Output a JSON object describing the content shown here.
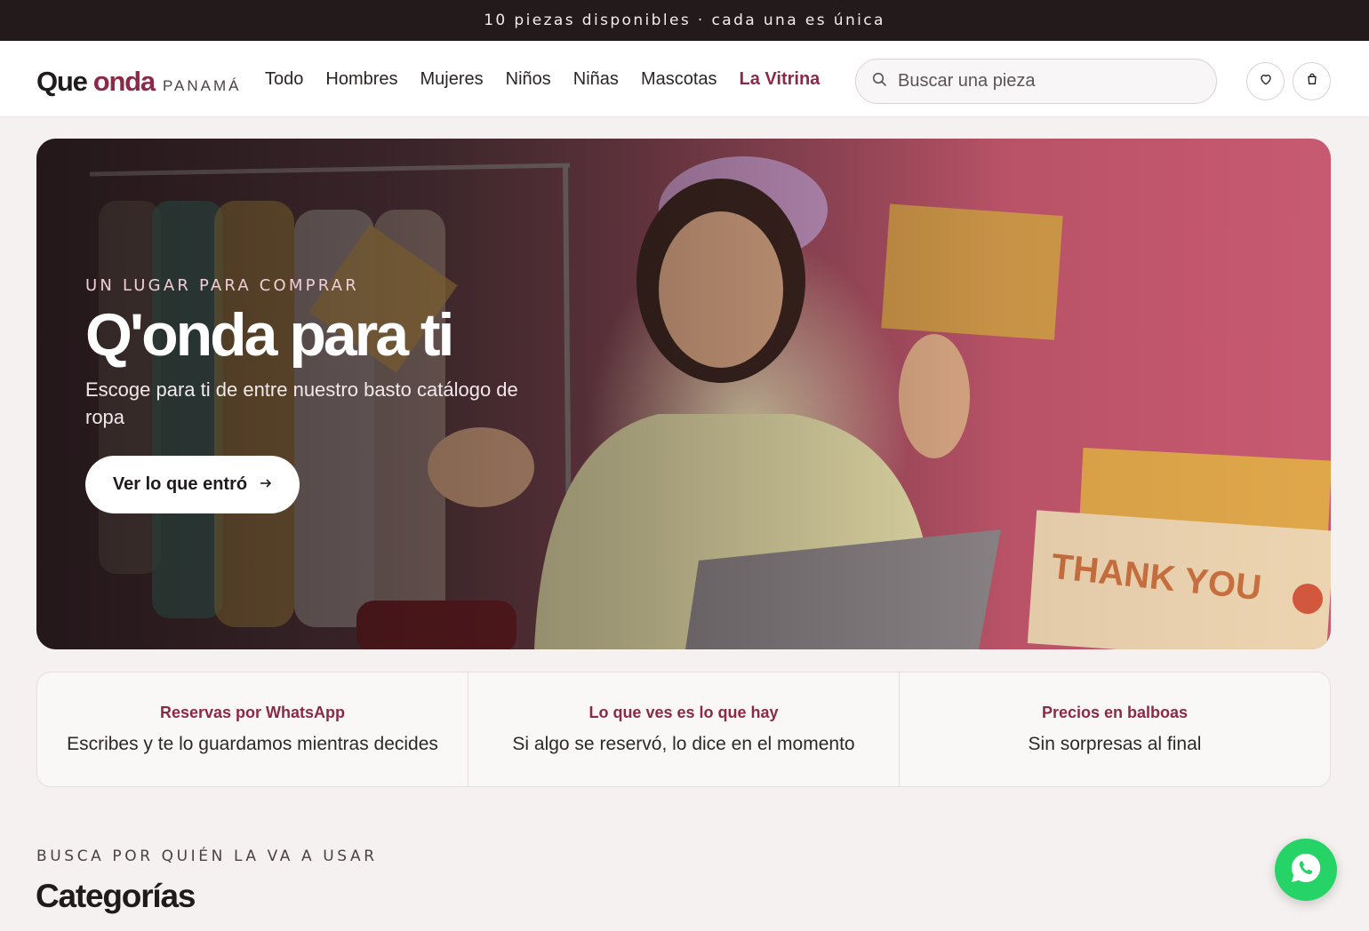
{
  "announcement": "10 piezas disponibles · cada una es única",
  "logo": {
    "part1": "Que",
    "part2": "onda",
    "part3": "PANAMÁ"
  },
  "nav": [
    {
      "label": "Todo"
    },
    {
      "label": "Hombres"
    },
    {
      "label": "Mujeres"
    },
    {
      "label": "Niños"
    },
    {
      "label": "Niñas"
    },
    {
      "label": "Mascotas"
    },
    {
      "label": "La Vitrina",
      "accent": true
    }
  ],
  "search": {
    "placeholder": "Buscar una pieza",
    "value": ""
  },
  "icons": {
    "search": "search-icon",
    "wishlist": "heart-icon",
    "cart": "bag-icon",
    "whatsapp": "whatsapp-icon",
    "cta_arrow": "arrow-right-icon"
  },
  "hero": {
    "eyebrow": "UN LUGAR PARA COMPRAR",
    "title": "Q'onda para ti",
    "subtitle": "Escoge para ti de entre nuestro basto catálogo de ropa",
    "cta": "Ver lo que entró"
  },
  "features": [
    {
      "title": "Reservas por WhatsApp",
      "desc": "Escribes y te lo guardamos mientras decides"
    },
    {
      "title": "Lo que ves es lo que hay",
      "desc": "Si algo se reservó, lo dice en el momento"
    },
    {
      "title": "Precios en balboas",
      "desc": "Sin sorpresas al final"
    }
  ],
  "categories": {
    "eyebrow": "BUSCA POR QUIÉN LA VA A USAR",
    "title": "Categorías"
  },
  "colors": {
    "accent": "#8a2a48",
    "dark": "#231a1c",
    "whatsapp": "#25d366"
  }
}
